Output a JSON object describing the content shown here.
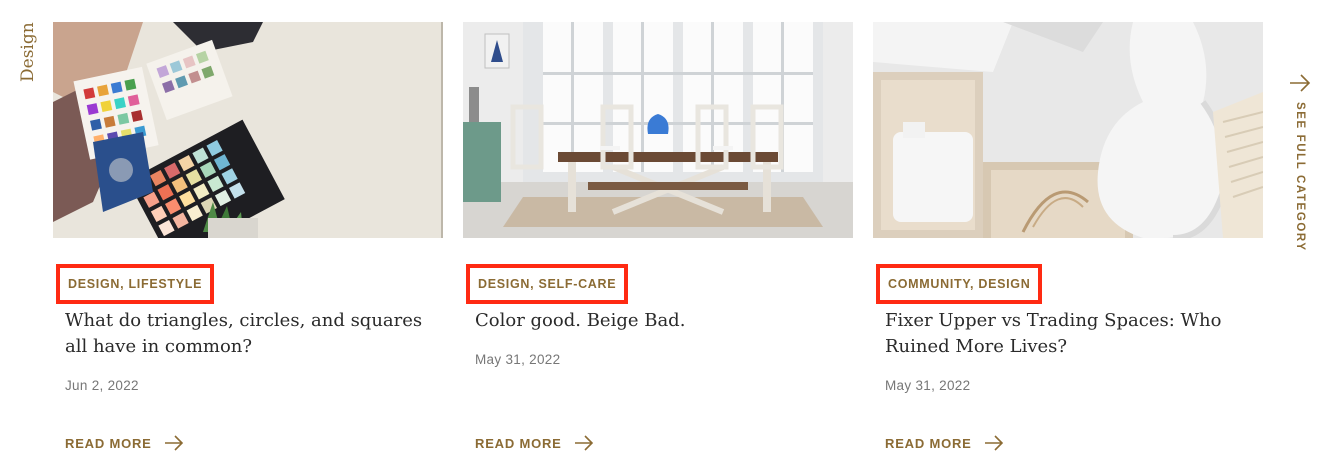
{
  "section": {
    "category_label": "Design"
  },
  "see_full_category": {
    "label": "SEE FULL CATEGORY",
    "icon": "arrow-right-icon"
  },
  "colors": {
    "accent": "#8b6b34",
    "highlight_border": "#ff2a12",
    "date_text": "#777777",
    "title_text": "#2a2a2a"
  },
  "cards": [
    {
      "categories": "DESIGN, LIFESTYLE",
      "title": "What do triangles, circles, and squares all have in common?",
      "date": "Jun 2, 2022",
      "read_more": "READ MORE",
      "image": "color-swatches-photo"
    },
    {
      "categories": "DESIGN, SELF-CARE",
      "title": "Color good. Beige Bad.",
      "date": "May 31, 2022",
      "read_more": "READ MORE",
      "image": "dining-room-photo"
    },
    {
      "categories": "COMMUNITY, DESIGN",
      "title": "Fixer Upper vs Trading Spaces: Who Ruined More Lives?",
      "date": "May 31, 2022",
      "read_more": "READ MORE",
      "image": "white-vase-photo"
    }
  ]
}
